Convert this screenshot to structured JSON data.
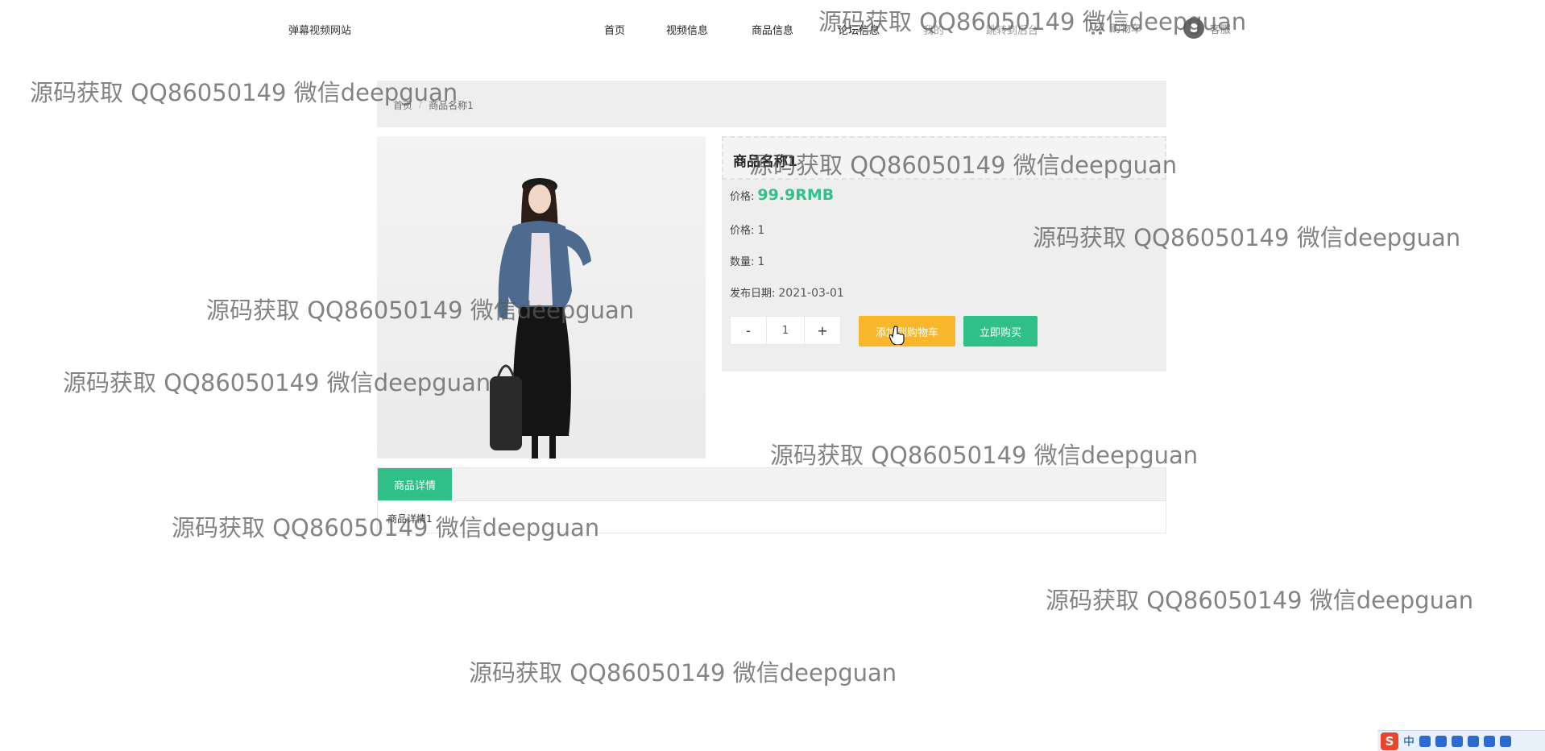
{
  "header": {
    "site_name": "弹幕视频网站",
    "nav": [
      {
        "label": "首页"
      },
      {
        "label": "视频信息"
      },
      {
        "label": "商品信息"
      },
      {
        "label": "论坛信息"
      },
      {
        "label": "我的"
      },
      {
        "label": "跳转到后台"
      }
    ],
    "cart_label": "购物车",
    "service_label": "客服"
  },
  "breadcrumb": {
    "home": "首页",
    "separator": "/",
    "current": "商品名称1"
  },
  "product": {
    "image_icon": "product-photo",
    "name": "商品名称1",
    "price_label": "价格:",
    "price_value": "99.9RMB",
    "price2_label": "价格:",
    "price2_value": "1",
    "quantity_label": "数量:",
    "quantity_value": "1",
    "date_label": "发布日期:",
    "date_value": "2021-03-01",
    "stepper": {
      "minus": "-",
      "value": "1",
      "plus": "+"
    },
    "add_to_cart": "添加到购物车",
    "buy_now": "立即购买"
  },
  "details": {
    "tab_label": "商品详情",
    "content": "商品详情1"
  },
  "watermark_text": "源码获取 QQ86050149 微信deepguan",
  "ime": {
    "logo": "S",
    "mode": "中"
  },
  "colors": {
    "accent_green": "#2fc087",
    "price_green": "#33c08a",
    "cart_orange": "#f8b62b",
    "panel_gray": "#eeeeee"
  }
}
